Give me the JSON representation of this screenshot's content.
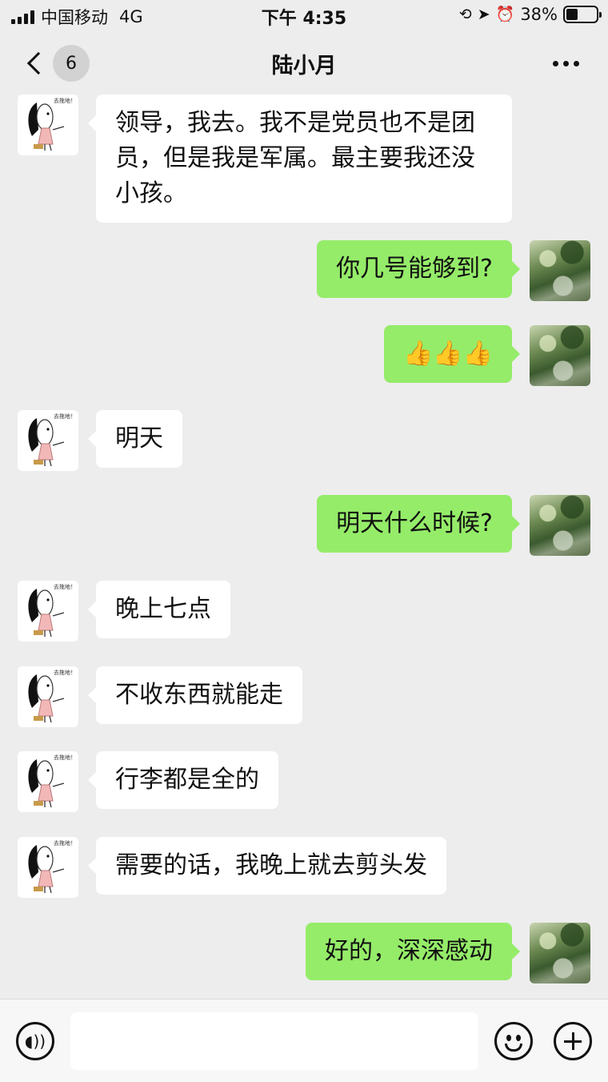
{
  "status_bar": {
    "carrier": "中国移动",
    "network": "4G",
    "time": "下午 4:35",
    "battery": "38%",
    "battery_level": 0.38
  },
  "nav": {
    "unread_count": "6",
    "title": "陆小月"
  },
  "contact_avatar": {
    "tag": "去拖地！",
    "icon": "cartoon-avatar"
  },
  "self_avatar": {
    "icon": "forest-avatar"
  },
  "messages": [
    {
      "side": "recv",
      "text": "领导，我去。我不是党员也不是团员，但是我是军属。最主要我还没小孩。"
    },
    {
      "side": "sent",
      "text": "你几号能够到?"
    },
    {
      "side": "sent",
      "text": "👍👍👍",
      "type": "emoji"
    },
    {
      "side": "recv",
      "text": "明天"
    },
    {
      "side": "sent",
      "text": "明天什么时候?"
    },
    {
      "side": "recv",
      "text": "晚上七点"
    },
    {
      "side": "recv",
      "text": "不收东西就能走"
    },
    {
      "side": "recv",
      "text": "行李都是全的"
    },
    {
      "side": "recv",
      "text": "需要的话，我晚上就去剪头发"
    },
    {
      "side": "sent",
      "text": "好的，深深感动"
    }
  ],
  "input_bar": {
    "placeholder": "",
    "voice_icon": "voice-icon",
    "emoji_icon": "emoji-icon",
    "plus_icon": "plus-icon"
  }
}
